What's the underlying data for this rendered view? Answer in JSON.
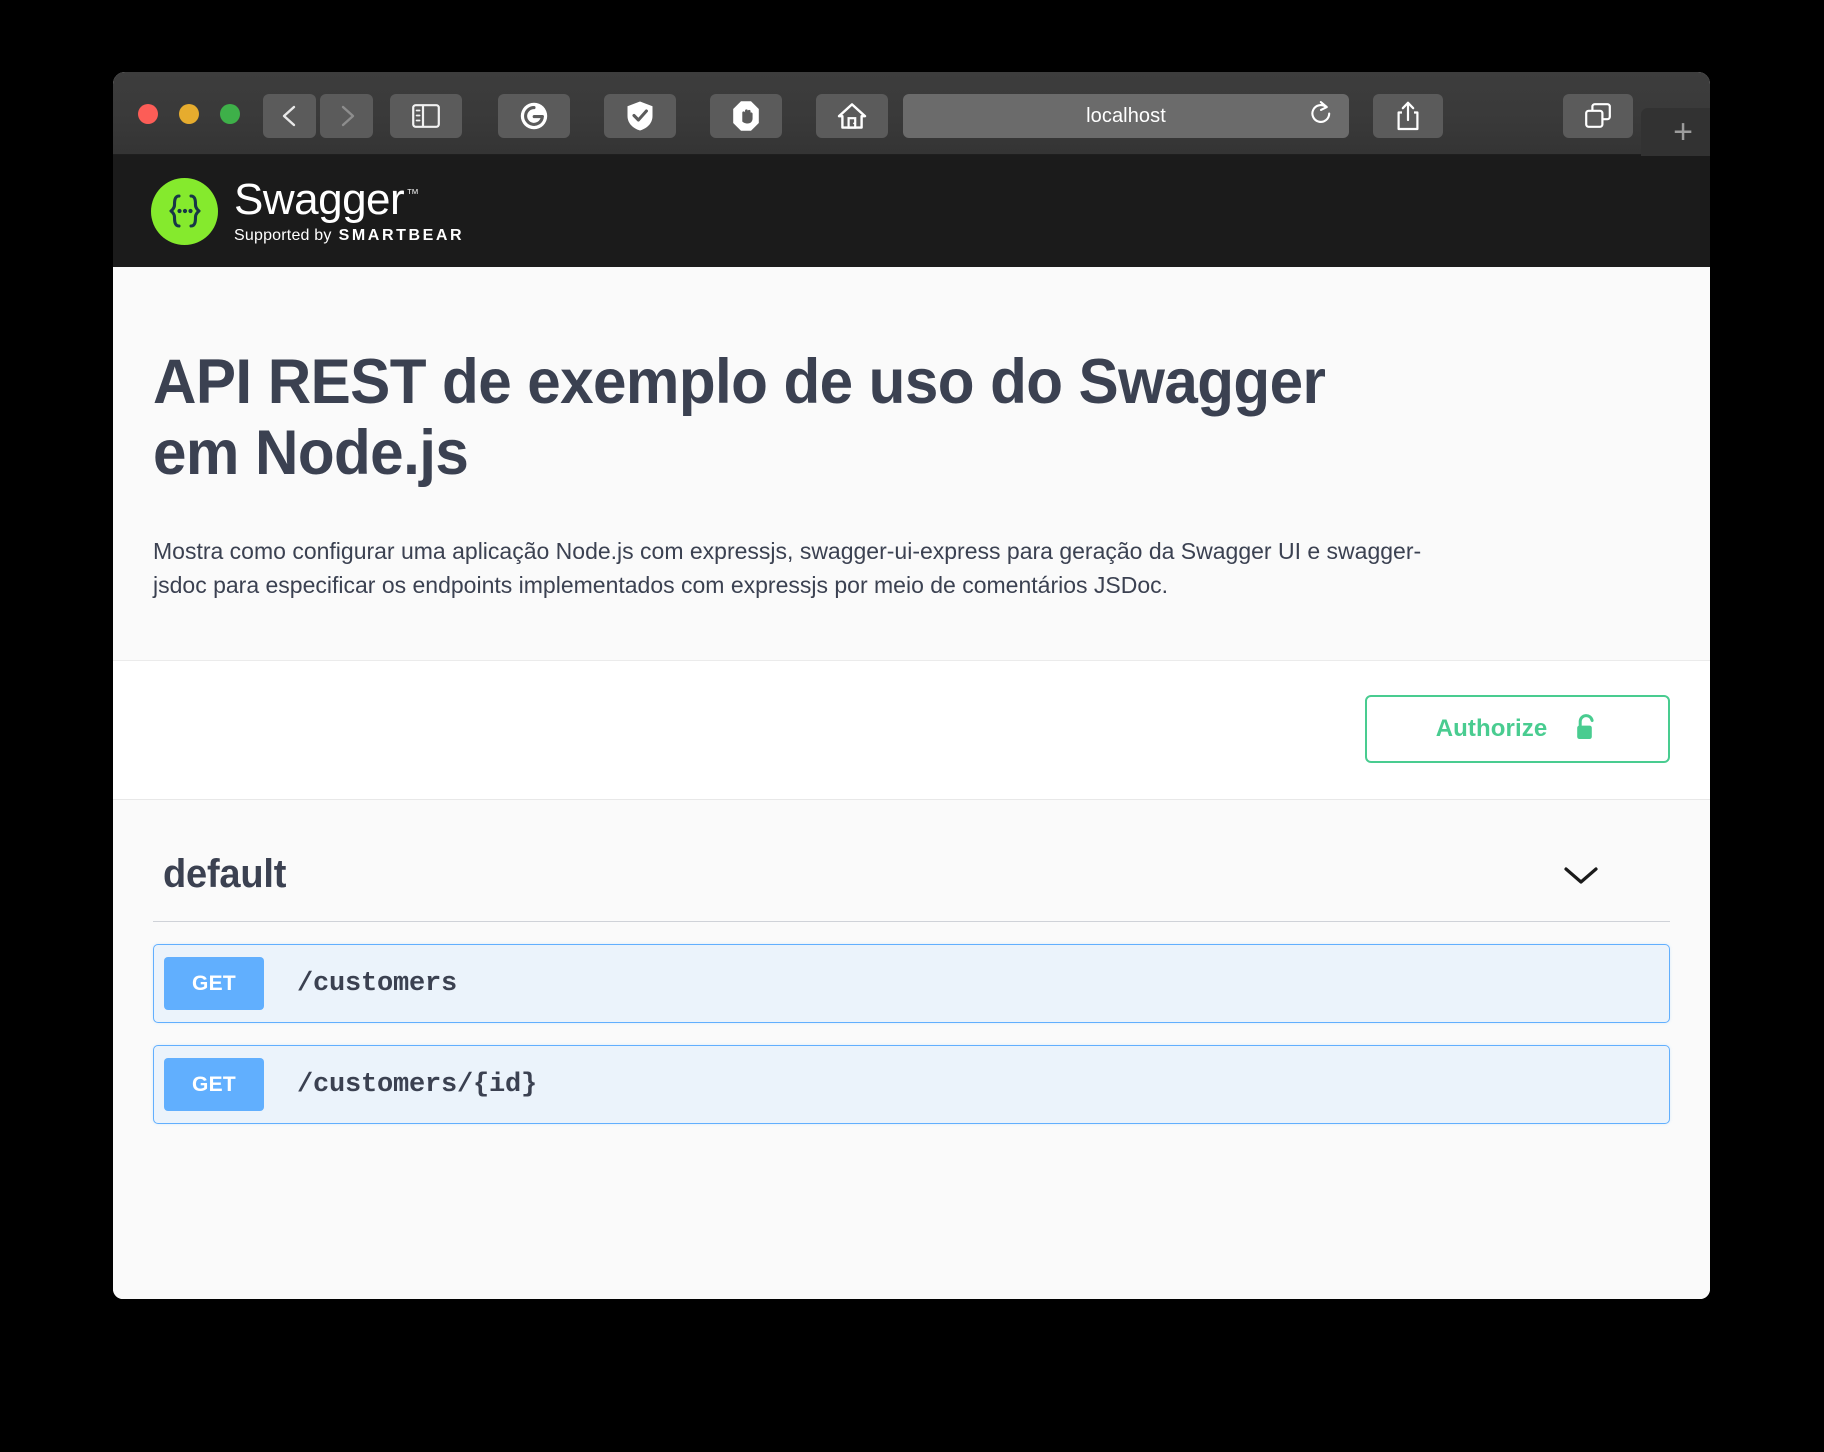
{
  "browser": {
    "url_text": "localhost",
    "traffic_lights": [
      "close",
      "minimize",
      "zoom"
    ],
    "toolbar_buttons": [
      {
        "name": "back",
        "icon": "chevron-left-icon"
      },
      {
        "name": "forward",
        "icon": "chevron-right-icon"
      },
      {
        "name": "sidebar",
        "icon": "sidebar-icon"
      },
      {
        "name": "grammarly",
        "icon": "grammarly-icon"
      },
      {
        "name": "shield",
        "icon": "shield-check-icon"
      },
      {
        "name": "adblock",
        "icon": "hand-stop-icon"
      },
      {
        "name": "home",
        "icon": "home-icon"
      },
      {
        "name": "reload",
        "icon": "reload-icon"
      },
      {
        "name": "share",
        "icon": "share-icon"
      },
      {
        "name": "tabs-overview",
        "icon": "tabs-icon"
      },
      {
        "name": "new-tab",
        "icon": "plus-icon"
      }
    ],
    "new_tab_label": "+"
  },
  "topbar": {
    "logo_braces": "{...}",
    "wordmark": "Swagger",
    "trademark": "™",
    "supported_by": "Supported by",
    "smartbear": "SMARTBEAR"
  },
  "info": {
    "title": "API REST de exemplo de uso do Swagger em Node.js",
    "description": "Mostra como configurar uma aplicação Node.js com expressjs, swagger-ui-express para geração da Swagger UI e swagger-jsdoc para especificar os endpoints implementados com expressjs por meio de comentários JSDoc."
  },
  "auth": {
    "authorize_label": "Authorize",
    "lock_state": "unlocked",
    "accent_color": "#49cc90"
  },
  "operations": {
    "tag": "default",
    "expanded": true,
    "chevron": "chevron-down-icon",
    "method_color": "#61affe",
    "items": [
      {
        "method": "GET",
        "path": "/customers"
      },
      {
        "method": "GET",
        "path": "/customers/{id}"
      }
    ]
  }
}
